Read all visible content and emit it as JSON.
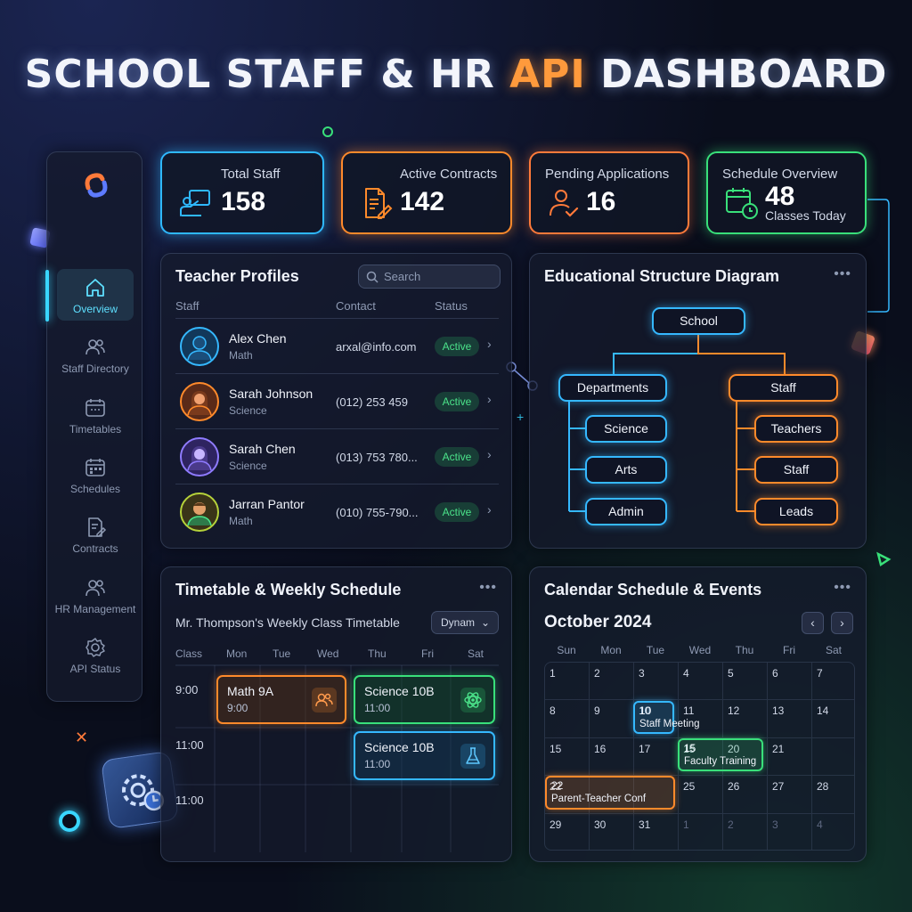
{
  "header": {
    "title_part1": "SCHOOL STAFF & HR ",
    "title_accent": "API",
    "title_part2": " DASHBOARD"
  },
  "sidebar": {
    "items": [
      {
        "label": "Overview",
        "icon": "home-icon",
        "active": true
      },
      {
        "label": "Staff Directory",
        "icon": "users-icon"
      },
      {
        "label": "Timetables",
        "icon": "calendar-icon"
      },
      {
        "label": "Schedules",
        "icon": "calendar-grid-icon"
      },
      {
        "label": "Contracts",
        "icon": "document-edit-icon"
      },
      {
        "label": "HR Management",
        "icon": "people-icon"
      },
      {
        "label": "API Status",
        "icon": "gear-icon"
      }
    ]
  },
  "stats": {
    "total_staff": {
      "label": "Total Staff",
      "value": "158",
      "icon": "teacher-board-icon",
      "color": "#2fb8ff"
    },
    "active_contracts": {
      "label": "Active Contracts",
      "value": "142",
      "icon": "contract-icon",
      "color": "#ff8a2b"
    },
    "pending_applications": {
      "label": "Pending Applications",
      "value": "16",
      "icon": "user-check-icon",
      "color": "#ff7a3a"
    },
    "schedule_overview": {
      "label": "Schedule Overview",
      "value": "48",
      "sub": "Classes Today",
      "icon": "calendar-clock-icon",
      "color": "#39e07a"
    }
  },
  "teacher_profiles": {
    "title": "Teacher Profiles",
    "search_placeholder": "Search",
    "columns": [
      "Staff",
      "Contact",
      "Status"
    ],
    "rows": [
      {
        "name": "Alex Chen",
        "subject": "Math",
        "contact": "arxal@info.com",
        "status": "Active"
      },
      {
        "name": "Sarah Johnson",
        "subject": "Science",
        "contact": "(012) 253 459",
        "status": "Active"
      },
      {
        "name": "Sarah Chen",
        "subject": "Science",
        "contact": "(013) 753 780...",
        "status": "Active"
      },
      {
        "name": "Jarran Pantor",
        "subject": "Math",
        "contact": "(010) 755-790...",
        "status": "Active"
      }
    ]
  },
  "diagram": {
    "title": "Educational Structure Diagram",
    "root": "School",
    "left_branch": {
      "label": "Departments",
      "children": [
        "Science",
        "Arts",
        "Admin"
      ]
    },
    "right_branch": {
      "label": "Staff",
      "children": [
        "Teachers",
        "Staff",
        "Leads"
      ]
    }
  },
  "timetable": {
    "title": "Timetable & Weekly Schedule",
    "subtitle": "Mr. Thompson's Weekly Class Timetable",
    "dropdown_value": "Dynam",
    "columns": [
      "Class",
      "Mon",
      "Tue",
      "Wed",
      "Thu",
      "Fri",
      "Sat"
    ],
    "times": [
      "9:00",
      "11:00",
      "11:00"
    ],
    "blocks": [
      {
        "title": "Math 9A",
        "time": "9:00",
        "color": "#ff8a2b",
        "icon": "users-icon"
      },
      {
        "title": "Science 10B",
        "time": "11:00",
        "color": "#39e07a",
        "icon": "atom-icon"
      },
      {
        "title": "Science 10B",
        "time": "11:00",
        "color": "#35b8ff",
        "icon": "flask-icon"
      }
    ]
  },
  "calendar": {
    "title": "Calendar Schedule & Events",
    "month": "October 2024",
    "weekdays": [
      "Sun",
      "Mon",
      "Tue",
      "Wed",
      "Thu",
      "Fri",
      "Sat"
    ],
    "weeks": [
      [
        "1",
        "2",
        "3",
        "4",
        "5",
        "6",
        "7"
      ],
      [
        "8",
        "9",
        "10",
        "11",
        "12",
        "13",
        "14"
      ],
      [
        "15",
        "16",
        "17",
        "15",
        "20",
        "21",
        ""
      ],
      [
        "22",
        "",
        "",
        "25",
        "26",
        "27",
        "28"
      ],
      [
        "29",
        "30",
        "31",
        "1",
        "2",
        "3",
        "4"
      ]
    ],
    "events": [
      {
        "label": "Staff Meeting",
        "day": "10",
        "color": "#35b8ff"
      },
      {
        "label": "Faculty Training",
        "day": "15",
        "color": "#39e07a"
      },
      {
        "label": "Parent-Teacher Conf",
        "day": "22",
        "color": "#ff8a2b"
      }
    ]
  }
}
